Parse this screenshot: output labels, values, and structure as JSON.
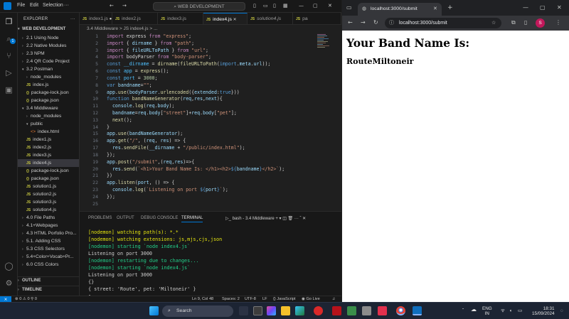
{
  "vscode": {
    "menu": [
      "File",
      "Edit",
      "Selection"
    ],
    "search_text": "WEB DEVELOPMENT",
    "sidebar_title": "EXPLORER",
    "workspace": "WEB DEVELOPMENT",
    "tree": [
      {
        "label": "2.1 Using Node",
        "depth": 1,
        "kind": "folder-closed"
      },
      {
        "label": "2.2 Native Modules",
        "depth": 1,
        "kind": "folder-closed"
      },
      {
        "label": "2.3 NPM",
        "depth": 1,
        "kind": "folder-closed"
      },
      {
        "label": "2.4 QR Code Project",
        "depth": 1,
        "kind": "folder-closed"
      },
      {
        "label": "3.2 Postman",
        "depth": 1,
        "kind": "folder-open"
      },
      {
        "label": "node_modules",
        "depth": 2,
        "kind": "folder-closed"
      },
      {
        "label": "index.js",
        "depth": 2,
        "kind": "js"
      },
      {
        "label": "package-lock.json",
        "depth": 2,
        "kind": "json"
      },
      {
        "label": "package.json",
        "depth": 2,
        "kind": "json"
      },
      {
        "label": "3.4 Middleware",
        "depth": 1,
        "kind": "folder-open"
      },
      {
        "label": "node_modules",
        "depth": 2,
        "kind": "folder-closed"
      },
      {
        "label": "public",
        "depth": 2,
        "kind": "folder-open"
      },
      {
        "label": "index.html",
        "depth": 3,
        "kind": "html"
      },
      {
        "label": "index1.js",
        "depth": 2,
        "kind": "js"
      },
      {
        "label": "index2.js",
        "depth": 2,
        "kind": "js"
      },
      {
        "label": "index3.js",
        "depth": 2,
        "kind": "js"
      },
      {
        "label": "index4.js",
        "depth": 2,
        "kind": "js",
        "selected": true
      },
      {
        "label": "package-lock.json",
        "depth": 2,
        "kind": "json"
      },
      {
        "label": "package.json",
        "depth": 2,
        "kind": "json"
      },
      {
        "label": "solution1.js",
        "depth": 2,
        "kind": "js"
      },
      {
        "label": "solution2.js",
        "depth": 2,
        "kind": "js"
      },
      {
        "label": "solution3.js",
        "depth": 2,
        "kind": "js"
      },
      {
        "label": "solution4.js",
        "depth": 2,
        "kind": "js"
      },
      {
        "label": "4.0 File Paths",
        "depth": 1,
        "kind": "folder-closed"
      },
      {
        "label": "4.1+Webpages",
        "depth": 1,
        "kind": "folder-closed"
      },
      {
        "label": "4.3 HTML Porfolio Pro...",
        "depth": 1,
        "kind": "folder-closed"
      },
      {
        "label": "5.1. Adding CSS",
        "depth": 1,
        "kind": "folder-closed"
      },
      {
        "label": "5.3 CSS Selectors",
        "depth": 1,
        "kind": "folder-closed"
      },
      {
        "label": "5.4+Color+Vocab+Pr...",
        "depth": 1,
        "kind": "folder-closed"
      },
      {
        "label": "6.0 CSS Colors",
        "depth": 1,
        "kind": "folder-closed"
      }
    ],
    "outline": "OUTLINE",
    "timeline": "TIMELINE",
    "tabs": [
      {
        "label": "index1.js",
        "dirty": true
      },
      {
        "label": "index2.js"
      },
      {
        "label": "index3.js"
      },
      {
        "label": "index4.js",
        "active": true
      },
      {
        "label": "solution4.js",
        "italic": true
      },
      {
        "label": "pa"
      }
    ],
    "breadcrumb": "3.4 Middleware > JS index4.js > ...",
    "code": [
      [
        [
          "k",
          "import"
        ],
        [
          "p",
          " express "
        ],
        [
          "k",
          "from"
        ],
        [
          "s",
          " \"express\""
        ],
        [
          "p",
          ";"
        ]
      ],
      [
        [
          "k",
          "import"
        ],
        [
          "p",
          " { "
        ],
        [
          "v",
          "dirname"
        ],
        [
          "p",
          " } "
        ],
        [
          "k",
          "from"
        ],
        [
          "s",
          " \"path\""
        ],
        [
          "p",
          ";"
        ]
      ],
      [
        [
          "k",
          "import"
        ],
        [
          "p",
          " { "
        ],
        [
          "v",
          "fileURLToPath"
        ],
        [
          "p",
          " } "
        ],
        [
          "k",
          "from"
        ],
        [
          "s",
          " \"url\""
        ],
        [
          "p",
          ";"
        ]
      ],
      [
        [
          "k",
          "import"
        ],
        [
          "p",
          " bodyParser "
        ],
        [
          "k",
          "from"
        ],
        [
          "s",
          " \"body-parser\""
        ],
        [
          "p",
          ";"
        ]
      ],
      [
        [
          "b",
          "const"
        ],
        [
          "c",
          " __dirname"
        ],
        [
          "p",
          " = "
        ],
        [
          "f",
          "dirname"
        ],
        [
          "p",
          "("
        ],
        [
          "f",
          "fileURLToPath"
        ],
        [
          "p",
          "("
        ],
        [
          "b",
          "import"
        ],
        [
          "p",
          "."
        ],
        [
          "v",
          "meta"
        ],
        [
          "p",
          "."
        ],
        [
          "v",
          "url"
        ],
        [
          "p",
          "));"
        ]
      ],
      [
        [
          "b",
          "const"
        ],
        [
          "c",
          " app"
        ],
        [
          "p",
          " = "
        ],
        [
          "f",
          "express"
        ],
        [
          "p",
          "();"
        ]
      ],
      [
        [
          "b",
          "const"
        ],
        [
          "c",
          " port"
        ],
        [
          "p",
          " = "
        ],
        [
          "n",
          "3000"
        ],
        [
          "p",
          ";"
        ]
      ],
      [
        [
          "b",
          "var"
        ],
        [
          "v",
          " bandname"
        ],
        [
          "p",
          "="
        ],
        [
          "s",
          "\"\""
        ],
        [
          "p",
          ";"
        ]
      ],
      [
        [
          "v",
          "app"
        ],
        [
          "p",
          "."
        ],
        [
          "f",
          "use"
        ],
        [
          "p",
          "("
        ],
        [
          "v",
          "bodyParser"
        ],
        [
          "p",
          "."
        ],
        [
          "f",
          "urlencoded"
        ],
        [
          "p",
          "({"
        ],
        [
          "v",
          "extended"
        ],
        [
          "p",
          ":"
        ],
        [
          "b",
          "true"
        ],
        [
          "p",
          "}))"
        ]
      ],
      [
        [
          "b",
          "function"
        ],
        [
          "f",
          " bandNameGenerator"
        ],
        [
          "p",
          "("
        ],
        [
          "v",
          "req"
        ],
        [
          "p",
          ","
        ],
        [
          "v",
          "res"
        ],
        [
          "p",
          ","
        ],
        [
          "v",
          "next"
        ],
        [
          "p",
          "){"
        ]
      ],
      [
        [
          "p",
          "  "
        ],
        [
          "v",
          "console"
        ],
        [
          "p",
          "."
        ],
        [
          "f",
          "log"
        ],
        [
          "p",
          "("
        ],
        [
          "v",
          "req"
        ],
        [
          "p",
          "."
        ],
        [
          "v",
          "body"
        ],
        [
          "p",
          ");"
        ]
      ],
      [
        [
          "p",
          "  "
        ],
        [
          "v",
          "bandname"
        ],
        [
          "p",
          "="
        ],
        [
          "v",
          "req"
        ],
        [
          "p",
          "."
        ],
        [
          "v",
          "body"
        ],
        [
          "p",
          "["
        ],
        [
          "s",
          "\"street\""
        ],
        [
          "p",
          "]+"
        ],
        [
          "v",
          "req"
        ],
        [
          "p",
          "."
        ],
        [
          "v",
          "body"
        ],
        [
          "p",
          "["
        ],
        [
          "s",
          "\"pet\""
        ],
        [
          "p",
          "];"
        ]
      ],
      [
        [
          "p",
          "  "
        ],
        [
          "f",
          "next"
        ],
        [
          "p",
          "();"
        ]
      ],
      [
        [
          "p",
          "}"
        ]
      ],
      [
        [
          "v",
          "app"
        ],
        [
          "p",
          "."
        ],
        [
          "f",
          "use"
        ],
        [
          "p",
          "("
        ],
        [
          "v",
          "bandNameGenerator"
        ],
        [
          "p",
          ");"
        ]
      ],
      [
        [
          "v",
          "app"
        ],
        [
          "p",
          "."
        ],
        [
          "f",
          "get"
        ],
        [
          "p",
          "("
        ],
        [
          "s",
          "\"/\""
        ],
        [
          "p",
          ", ("
        ],
        [
          "v",
          "req"
        ],
        [
          "p",
          ", "
        ],
        [
          "v",
          "res"
        ],
        [
          "p",
          ") => {"
        ]
      ],
      [
        [
          "p",
          "  "
        ],
        [
          "v",
          "res"
        ],
        [
          "p",
          "."
        ],
        [
          "f",
          "sendFile"
        ],
        [
          "p",
          "("
        ],
        [
          "v",
          "__dirname"
        ],
        [
          "p",
          " + "
        ],
        [
          "s",
          "\"/public/index.html\""
        ],
        [
          "p",
          ");"
        ]
      ],
      [
        [
          "p",
          "});"
        ]
      ],
      [
        [
          "v",
          "app"
        ],
        [
          "p",
          "."
        ],
        [
          "f",
          "post"
        ],
        [
          "p",
          "("
        ],
        [
          "s",
          "\"/submit\""
        ],
        [
          "p",
          ",("
        ],
        [
          "v",
          "req"
        ],
        [
          "p",
          ","
        ],
        [
          "v",
          "res"
        ],
        [
          "p",
          ")=>{"
        ]
      ],
      [
        [
          "p",
          "  "
        ],
        [
          "v",
          "res"
        ],
        [
          "p",
          "."
        ],
        [
          "f",
          "send"
        ],
        [
          "p",
          "("
        ],
        [
          "s",
          "`<h1>Your Band Name Is: </h1><h2>"
        ],
        [
          "b",
          "${"
        ],
        [
          "v",
          "bandname"
        ],
        [
          "b",
          "}"
        ],
        [
          "s",
          "</h2>`"
        ],
        [
          "p",
          ");"
        ]
      ],
      [
        [
          "p",
          "})"
        ]
      ],
      [
        [
          "v",
          "app"
        ],
        [
          "p",
          "."
        ],
        [
          "f",
          "listen"
        ],
        [
          "p",
          "("
        ],
        [
          "v",
          "port"
        ],
        [
          "p",
          ", () => {"
        ]
      ],
      [
        [
          "p",
          "  "
        ],
        [
          "v",
          "console"
        ],
        [
          "p",
          "."
        ],
        [
          "f",
          "log"
        ],
        [
          "p",
          "("
        ],
        [
          "s",
          "`Listening on port "
        ],
        [
          "b",
          "${"
        ],
        [
          "v",
          "port"
        ],
        [
          "b",
          "}"
        ],
        [
          "s",
          "`"
        ],
        [
          "p",
          ");"
        ]
      ],
      [
        [
          "p",
          "});"
        ]
      ],
      [
        [
          "p",
          ""
        ]
      ]
    ],
    "panel_tabs": [
      "PROBLEMS",
      "OUTPUT",
      "DEBUG CONSOLE",
      "TERMINAL"
    ],
    "terminal_name": "bash - 3.4 Middleware",
    "terminal": [
      {
        "text": "[nodemon] watching path(s): *.*",
        "color": "#e5e510"
      },
      {
        "text": "[nodemon] watching extensions: js,mjs,cjs,json",
        "color": "#e5e510"
      },
      {
        "text": "[nodemon] starting `node index4.js`",
        "color": "#23d18b"
      },
      {
        "text": "Listening on port 3000",
        "color": "#cccccc"
      },
      {
        "text": "[nodemon] restarting due to changes...",
        "color": "#23d18b"
      },
      {
        "text": "[nodemon] starting `node index4.js`",
        "color": "#23d18b"
      },
      {
        "text": "Listening on port 3000",
        "color": "#cccccc"
      },
      {
        "text": "{}",
        "color": "#cccccc"
      },
      {
        "text": "{ street: 'Route', pet: 'Miltoneir' }",
        "color": "#cccccc"
      }
    ],
    "status": {
      "errors": "0",
      "warnings": "0",
      "ports": "0",
      "position": "Ln 9, Col 48",
      "spaces": "Spaces: 2",
      "encoding": "UTF-8",
      "eol": "LF",
      "language": "{} JavaScript",
      "golive": "Go Live"
    }
  },
  "browser": {
    "tab_title": "localhost:3000/submit",
    "url": "localhost:3000/submit",
    "avatar": "S",
    "page_h1": "Your Band Name Is:",
    "page_h2": "RouteMiltoneir"
  },
  "taskbar": {
    "search": "Search",
    "lang_top": "ENG",
    "lang_bottom": "IN",
    "time": "18:31",
    "date": "15/09/2024"
  },
  "colors": {
    "accent": "#0078d4",
    "keyword": "#c586c0",
    "builtin": "#569cd6",
    "string": "#ce9178",
    "function": "#dcdcaa",
    "variable": "#9cdcfe",
    "number": "#b5cea8",
    "constant": "#4fc1ff"
  }
}
